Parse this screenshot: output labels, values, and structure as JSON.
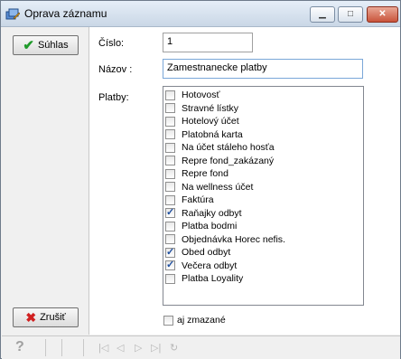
{
  "window": {
    "title": "Oprava záznamu"
  },
  "buttons": {
    "suhlas": "Súhlas",
    "zrusit": "Zrušiť"
  },
  "form": {
    "cislo_label": "Číslo:",
    "cislo_value": "1",
    "nazov_label": "Názov :",
    "nazov_value": "Zamestnanecke platby",
    "platby_label": "Platby:",
    "platby": [
      {
        "label": "Hotovosť",
        "checked": false
      },
      {
        "label": "Stravné lístky",
        "checked": false
      },
      {
        "label": "Hotelový účet",
        "checked": false
      },
      {
        "label": "Platobná karta",
        "checked": false
      },
      {
        "label": "Na účet stáleho hosťa",
        "checked": false
      },
      {
        "label": "Repre fond_zakázaný",
        "checked": false
      },
      {
        "label": "Repre fond",
        "checked": false
      },
      {
        "label": "Na wellness účet",
        "checked": false
      },
      {
        "label": "Faktúra",
        "checked": false
      },
      {
        "label": "Raňajky odbyt",
        "checked": true
      },
      {
        "label": "Platba bodmi",
        "checked": false
      },
      {
        "label": "Objednávka Horec nefis.",
        "checked": false
      },
      {
        "label": "Obed odbyt",
        "checked": true
      },
      {
        "label": "Večera odbyt",
        "checked": true
      },
      {
        "label": "Platba Loyality",
        "checked": false
      }
    ],
    "zmazane_label": "aj zmazané",
    "zmazane_checked": false
  },
  "statusbar": {
    "help_icon": "question-icon"
  }
}
